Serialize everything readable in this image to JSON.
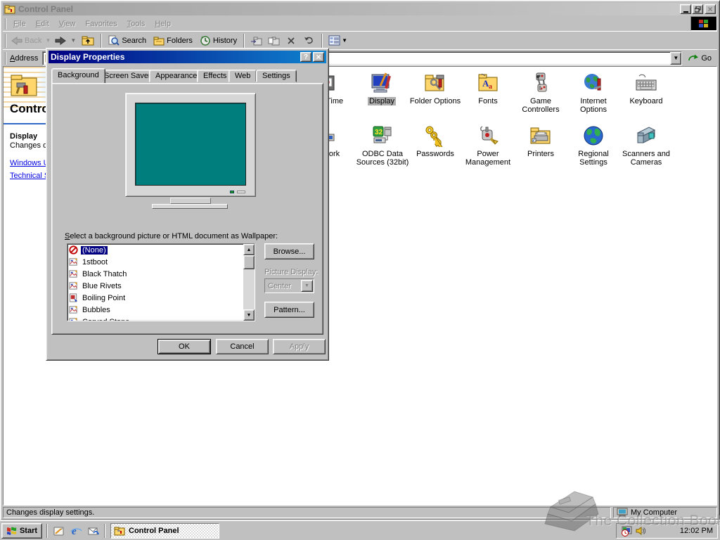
{
  "window": {
    "title": "Control Panel",
    "menu": [
      "File",
      "Edit",
      "View",
      "Favorites",
      "Tools",
      "Help"
    ],
    "toolbar": {
      "back": "Back",
      "search": "Search",
      "folders": "Folders",
      "history": "History"
    },
    "address": {
      "label": "Address",
      "go": "Go"
    },
    "status_left": "Changes display settings.",
    "status_right": "My Computer"
  },
  "sidebar": {
    "title": "Control Panel",
    "selected_item": "Display",
    "selected_desc": "Changes display settings.",
    "links": [
      "Windows Update",
      "Technical Support"
    ]
  },
  "control_panel_icons": [
    {
      "label": "Date/Time",
      "icon": "date-time-icon"
    },
    {
      "label": "Display",
      "icon": "display-icon",
      "selected": true
    },
    {
      "label": "Folder Options",
      "icon": "folder-options-icon"
    },
    {
      "label": "Fonts",
      "icon": "fonts-icon"
    },
    {
      "label": "Game Controllers",
      "icon": "game-controllers-icon"
    },
    {
      "label": "Internet Options",
      "icon": "internet-options-icon"
    },
    {
      "label": "Keyboard",
      "icon": "keyboard-icon"
    },
    {
      "label": "Network",
      "icon": "network-icon"
    },
    {
      "label": "ODBC Data Sources (32bit)",
      "icon": "odbc-icon"
    },
    {
      "label": "Passwords",
      "icon": "passwords-icon"
    },
    {
      "label": "Power Management",
      "icon": "power-management-icon"
    },
    {
      "label": "Printers",
      "icon": "printers-icon"
    },
    {
      "label": "Regional Settings",
      "icon": "regional-settings-icon"
    },
    {
      "label": "Scanners and Cameras",
      "icon": "scanners-cameras-icon"
    }
  ],
  "dialog": {
    "title": "Display Properties",
    "tabs": [
      "Background",
      "Screen Saver",
      "Appearance",
      "Effects",
      "Web",
      "Settings"
    ],
    "active_tab": "Background",
    "wallpaper_label": "Select a background picture or HTML document as Wallpaper:",
    "wallpaper_items": [
      "(None)",
      "1stboot",
      "Black Thatch",
      "Blue Rivets",
      "Boiling Point",
      "Bubbles",
      "Carved Stone"
    ],
    "selected_wallpaper": "(None)",
    "browse_button": "Browse...",
    "picture_display_label": "Picture Display:",
    "picture_display_value": "Center",
    "pattern_button": "Pattern...",
    "ok": "OK",
    "cancel": "Cancel",
    "apply": "Apply"
  },
  "taskbar": {
    "start": "Start",
    "task": "Control Panel",
    "time": "12:02 PM"
  },
  "watermark_text": "The Collection Book",
  "colors": {
    "chrome": "#c0c0c0",
    "titlebar_active_start": "#000080",
    "titlebar_active_end": "#1084d0",
    "selection": "#000080",
    "monitor_screen_teal": "#007d7d",
    "link_blue": "#0000e0"
  }
}
